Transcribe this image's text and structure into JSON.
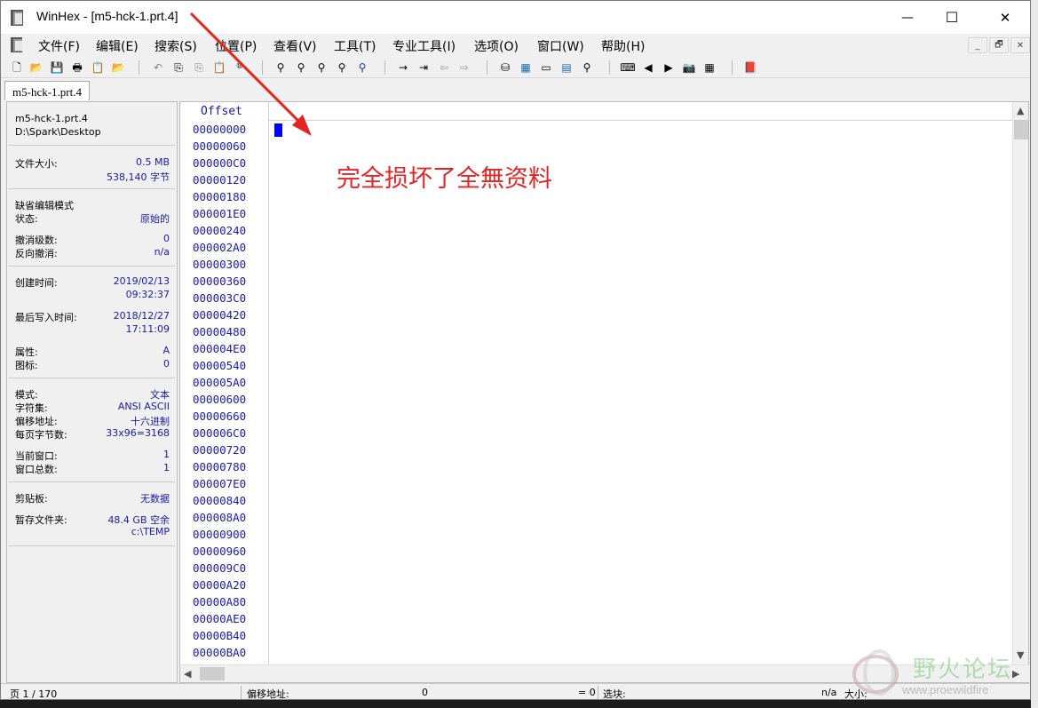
{
  "window": {
    "title": "WinHex - [m5-hck-1.prt.4]",
    "minimize_glyph": "—",
    "maximize_glyph": "☐",
    "close_glyph": "✕"
  },
  "menu": [
    "文件(F)",
    "编辑(E)",
    "搜索(S)",
    "位置(P)",
    "查看(V)",
    "工具(T)",
    "专业工具(I)",
    "选项(O)",
    "窗口(W)",
    "帮助(H)"
  ],
  "mdi_buttons": [
    "_",
    "🗗",
    "✕"
  ],
  "toolbar_icons": [
    {
      "name": "new-file-icon",
      "glyph": "🗋"
    },
    {
      "name": "open-folder-icon",
      "glyph": "📂"
    },
    {
      "name": "save-icon",
      "glyph": "💾"
    },
    {
      "name": "print-icon",
      "glyph": "🖶"
    },
    {
      "name": "properties-icon",
      "glyph": "📋"
    },
    {
      "name": "open-folder-2-icon",
      "glyph": "📂"
    },
    {
      "name": "undo-icon",
      "glyph": "↶"
    },
    {
      "name": "copy-icon",
      "glyph": "⎘"
    },
    {
      "name": "copy-block-icon",
      "glyph": "⎘"
    },
    {
      "name": "paste-icon",
      "glyph": "📋"
    },
    {
      "name": "write-binary-icon",
      "glyph": "⑩"
    },
    {
      "name": "find-text-icon",
      "glyph": "⚲"
    },
    {
      "name": "find-hex-icon",
      "glyph": "⚲"
    },
    {
      "name": "replace-text-icon",
      "glyph": "⚲"
    },
    {
      "name": "replace-hex-icon",
      "glyph": "⚲"
    },
    {
      "name": "find-again-icon",
      "glyph": "⚲"
    },
    {
      "name": "goto-offset-icon",
      "glyph": "→"
    },
    {
      "name": "goto-page-icon",
      "glyph": "⇥"
    },
    {
      "name": "back-icon",
      "glyph": "⇦"
    },
    {
      "name": "forward-icon",
      "glyph": "⇨"
    },
    {
      "name": "disk-icon",
      "glyph": "⛁"
    },
    {
      "name": "ram-editor-icon",
      "glyph": "▦"
    },
    {
      "name": "disk-tools-icon",
      "glyph": "▭"
    },
    {
      "name": "calculator-icon",
      "glyph": "▤"
    },
    {
      "name": "zoom-icon",
      "glyph": "⚲"
    },
    {
      "name": "analyze-icon",
      "glyph": "⌨"
    },
    {
      "name": "prev-icon",
      "glyph": "◀"
    },
    {
      "name": "next-icon",
      "glyph": "▶"
    },
    {
      "name": "camera-icon",
      "glyph": "📷"
    },
    {
      "name": "template-icon",
      "glyph": "▦"
    },
    {
      "name": "book-icon",
      "glyph": "📕"
    }
  ],
  "tab": {
    "label": "m5-hck-1.prt.4"
  },
  "info": {
    "filename": "m5-hck-1.prt.4",
    "path": "D:\\Spark\\Desktop",
    "filesize_label": "文件大小:",
    "filesize_mb": "0.5 MB",
    "filesize_bytes": "538,140 字节",
    "default_edit_mode_label": "缺省编辑模式",
    "state_label": "状态:",
    "state_value": "原始的",
    "undo_level_label": "撤消级数:",
    "undo_level_value": "0",
    "reverse_undo_label": "反向撤消:",
    "reverse_undo_value": "n/a",
    "created_label": "创建时间:",
    "created_date": "2019/02/13",
    "created_time": "09:32:37",
    "last_write_label": "最后写入时间:",
    "last_write_date": "2018/12/27",
    "last_write_time": "17:11:09",
    "attr_label": "属性:",
    "attr_value": "A",
    "icon_label": "图标:",
    "icon_value": "0",
    "mode_label": "模式:",
    "mode_value": "文本",
    "charset_label": "字符集:",
    "charset_value": "ANSI ASCII",
    "offset_label": "偏移地址:",
    "offset_value": "十六进制",
    "bytes_per_page_label": "每页字节数:",
    "bytes_per_page_value": "33x96=3168",
    "current_window_label": "当前窗口:",
    "current_window_value": "1",
    "total_windows_label": "窗口总数:",
    "total_windows_value": "1",
    "clipboard_label": "剪贴板:",
    "clipboard_value": "无数据",
    "temp_folder_label": "暂存文件夹:",
    "temp_free": "48.4 GB 空余",
    "temp_path": "c:\\TEMP"
  },
  "editor": {
    "offset_header": "Offset",
    "offsets": [
      "00000000",
      "00000060",
      "000000C0",
      "00000120",
      "00000180",
      "000001E0",
      "00000240",
      "000002A0",
      "00000300",
      "00000360",
      "000003C0",
      "00000420",
      "00000480",
      "000004E0",
      "00000540",
      "000005A0",
      "00000600",
      "00000660",
      "000006C0",
      "00000720",
      "00000780",
      "000007E0",
      "00000840",
      "000008A0",
      "00000900",
      "00000960",
      "000009C0",
      "00000A20",
      "00000A80",
      "00000AE0",
      "00000B40",
      "00000BA0"
    ],
    "annotation": "完全损坏了全無资料"
  },
  "status": {
    "page": "页 1 / 170",
    "offset_label": "偏移地址:",
    "offset_value": "0",
    "equals": "= 0",
    "block_label": "选块:",
    "block_value": "n/a",
    "size_label": "大小:"
  },
  "watermark": {
    "text": "野火论坛",
    "url": "www.proewildfire"
  },
  "colors": {
    "annotation": "#e22424",
    "info_value": "#1a1aa8",
    "cursor": "#0000ff"
  }
}
